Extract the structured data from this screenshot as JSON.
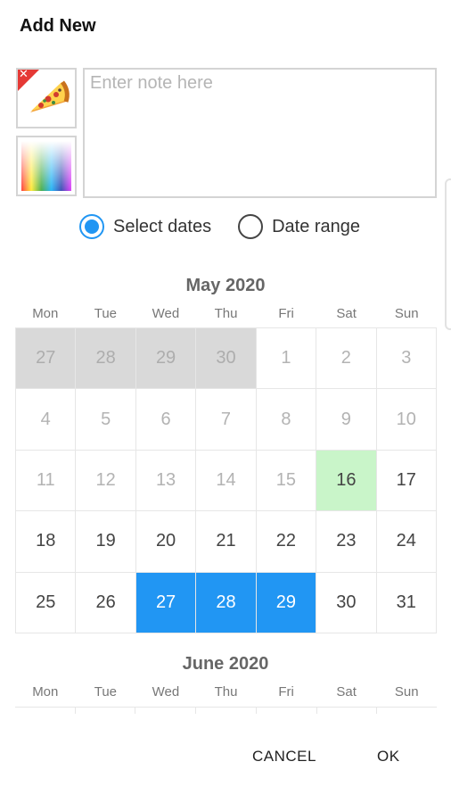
{
  "dialog": {
    "title": "Add New"
  },
  "note": {
    "placeholder": "Enter note here",
    "value": ""
  },
  "icons": {
    "food": "pizza-icon",
    "remove": "close-icon",
    "color": "color-palette-icon"
  },
  "colors": {
    "accent": "#2196f3",
    "today": "#c9f5c9",
    "remove": "#e53935"
  },
  "mode": {
    "options": [
      {
        "label": "Select dates",
        "selected": true
      },
      {
        "label": "Date range",
        "selected": false
      }
    ]
  },
  "weekdays": [
    "Mon",
    "Tue",
    "Wed",
    "Thu",
    "Fri",
    "Sat",
    "Sun"
  ],
  "months": [
    {
      "title": "May 2020",
      "days": [
        {
          "n": "27",
          "state": "prev"
        },
        {
          "n": "28",
          "state": "prev"
        },
        {
          "n": "29",
          "state": "prev"
        },
        {
          "n": "30",
          "state": "prev"
        },
        {
          "n": "1",
          "state": "past"
        },
        {
          "n": "2",
          "state": "past"
        },
        {
          "n": "3",
          "state": "past"
        },
        {
          "n": "4",
          "state": "past"
        },
        {
          "n": "5",
          "state": "past"
        },
        {
          "n": "6",
          "state": "past"
        },
        {
          "n": "7",
          "state": "past"
        },
        {
          "n": "8",
          "state": "past"
        },
        {
          "n": "9",
          "state": "past"
        },
        {
          "n": "10",
          "state": "past"
        },
        {
          "n": "11",
          "state": "past"
        },
        {
          "n": "12",
          "state": "past"
        },
        {
          "n": "13",
          "state": "past"
        },
        {
          "n": "14",
          "state": "past"
        },
        {
          "n": "15",
          "state": "past"
        },
        {
          "n": "16",
          "state": "today"
        },
        {
          "n": "17",
          "state": "normal"
        },
        {
          "n": "18",
          "state": "normal"
        },
        {
          "n": "19",
          "state": "normal"
        },
        {
          "n": "20",
          "state": "normal"
        },
        {
          "n": "21",
          "state": "normal"
        },
        {
          "n": "22",
          "state": "normal"
        },
        {
          "n": "23",
          "state": "normal"
        },
        {
          "n": "24",
          "state": "normal"
        },
        {
          "n": "25",
          "state": "normal"
        },
        {
          "n": "26",
          "state": "normal"
        },
        {
          "n": "27",
          "state": "selected"
        },
        {
          "n": "28",
          "state": "selected"
        },
        {
          "n": "29",
          "state": "selected"
        },
        {
          "n": "30",
          "state": "normal"
        },
        {
          "n": "31",
          "state": "normal"
        }
      ]
    },
    {
      "title": "June 2020"
    }
  ],
  "actions": {
    "cancel": "CANCEL",
    "ok": "OK"
  }
}
